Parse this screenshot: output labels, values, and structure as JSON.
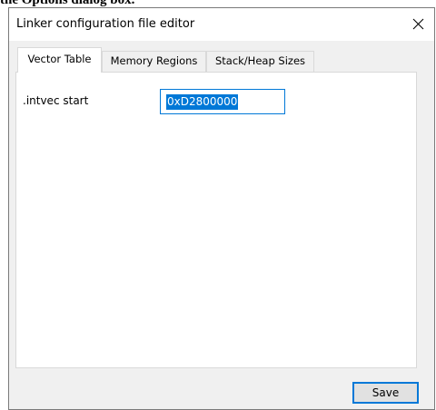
{
  "page": {
    "heading_fragment": "the Options dialog box."
  },
  "dialog": {
    "title": "Linker configuration file editor",
    "close_glyph": "X"
  },
  "tabs": [
    {
      "label": "Vector Table",
      "active": true
    },
    {
      "label": "Memory Regions",
      "active": false
    },
    {
      "label": "Stack/Heap Sizes",
      "active": false
    }
  ],
  "vector_table": {
    "intvec_label": ".intvec start",
    "intvec_value": "0xD2800000"
  },
  "footer": {
    "save_label": "Save"
  },
  "colors": {
    "accent": "#0078d7",
    "window_bg": "#f0f0f0",
    "panel_bg": "#ffffff",
    "border": "#7a7a7a"
  },
  "icons": {
    "close": "close-icon"
  }
}
